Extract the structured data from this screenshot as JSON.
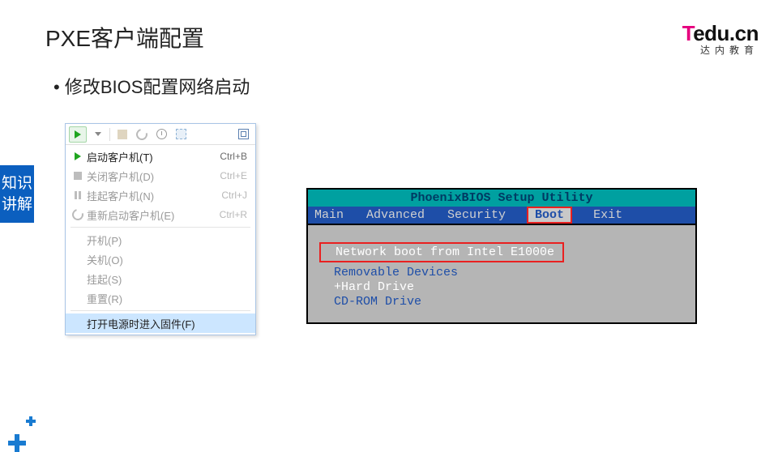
{
  "slide": {
    "title": "PXE客户端配置",
    "bullet": "修改BIOS配置网络启动",
    "sidebar_label": "知识讲解"
  },
  "logo": {
    "brand_t": "T",
    "brand_rest": "edu.cn",
    "sub": "达内教育"
  },
  "menu": {
    "items": [
      {
        "label": "启动客户机(T)",
        "shortcut": "Ctrl+B",
        "dim": false,
        "icon": "play"
      },
      {
        "label": "关闭客户机(D)",
        "shortcut": "Ctrl+E",
        "dim": true,
        "icon": "stop"
      },
      {
        "label": "挂起客户机(N)",
        "shortcut": "Ctrl+J",
        "dim": true,
        "icon": "pause"
      },
      {
        "label": "重新启动客户机(E)",
        "shortcut": "Ctrl+R",
        "dim": true,
        "icon": "restart"
      }
    ],
    "items2": [
      {
        "label": "开机(P)"
      },
      {
        "label": "关机(O)"
      },
      {
        "label": "挂起(S)"
      },
      {
        "label": "重置(R)"
      }
    ],
    "firmware": "打开电源时进入固件(F)"
  },
  "bios": {
    "title": "PhoenixBIOS Setup Utility",
    "tabs": [
      "Main",
      "Advanced",
      "Security",
      "Boot",
      "Exit"
    ],
    "selected_tab": "Boot",
    "boot_order": [
      "Network boot from Intel E1000e",
      "Removable Devices",
      "+Hard Drive",
      "CD-ROM Drive"
    ]
  }
}
